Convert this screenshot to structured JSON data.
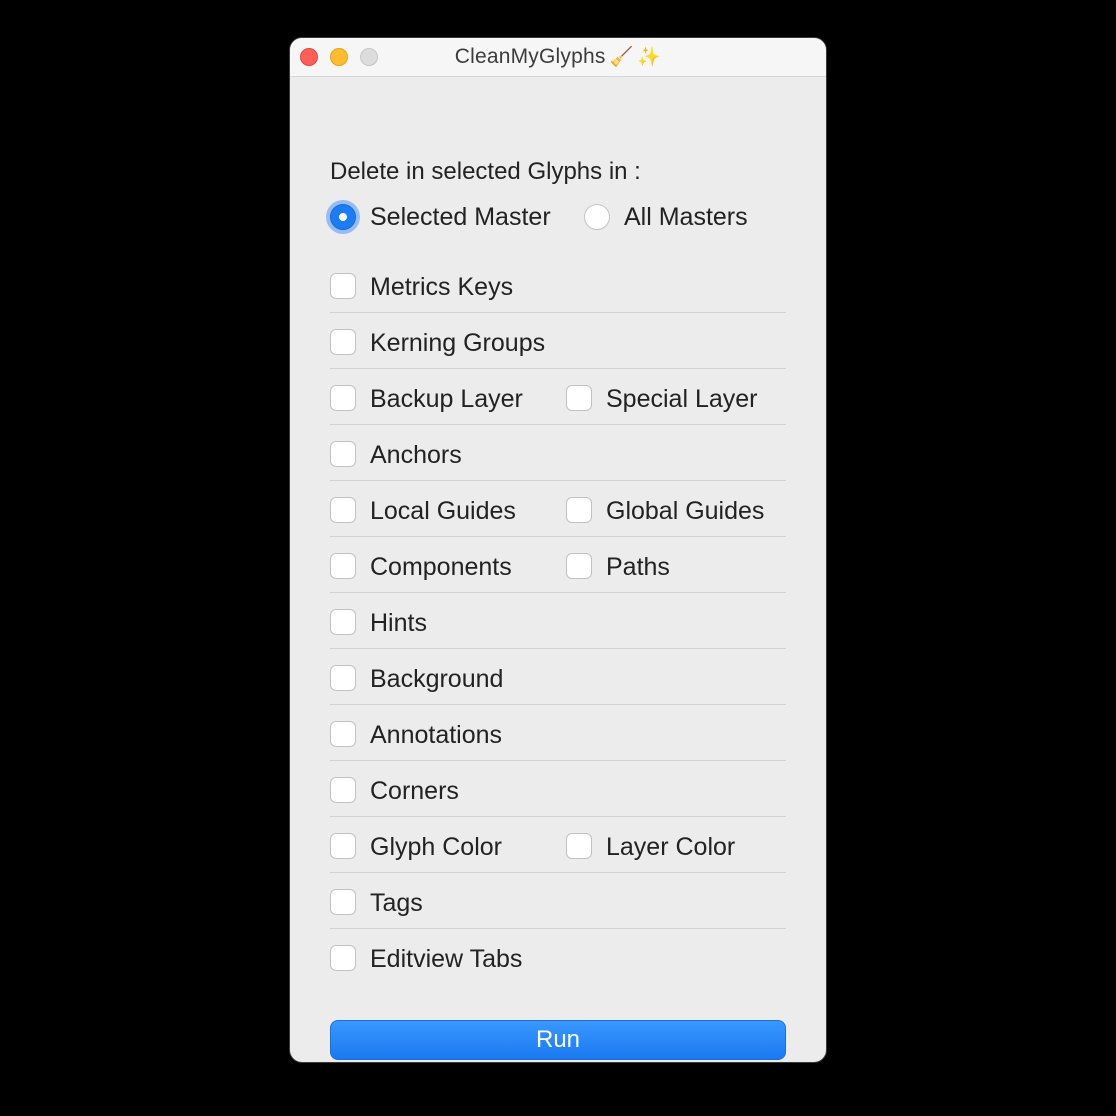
{
  "window": {
    "title": "CleanMyGlyphs",
    "title_icons": [
      "broom-icon",
      "sparkles-icon"
    ]
  },
  "heading": "Delete in selected Glyphs in :",
  "scope": {
    "options": [
      {
        "label": "Selected Master",
        "selected": true
      },
      {
        "label": "All Masters",
        "selected": false
      }
    ]
  },
  "options": [
    {
      "left": {
        "label": "Metrics Keys",
        "checked": false
      }
    },
    {
      "left": {
        "label": "Kerning Groups",
        "checked": false
      }
    },
    {
      "left": {
        "label": "Backup Layer",
        "checked": false
      },
      "right": {
        "label": "Special Layer",
        "checked": false
      }
    },
    {
      "left": {
        "label": "Anchors",
        "checked": false
      }
    },
    {
      "left": {
        "label": "Local Guides",
        "checked": false
      },
      "right": {
        "label": "Global Guides",
        "checked": false
      }
    },
    {
      "left": {
        "label": "Components",
        "checked": false
      },
      "right": {
        "label": "Paths",
        "checked": false
      }
    },
    {
      "left": {
        "label": "Hints",
        "checked": false
      }
    },
    {
      "left": {
        "label": "Background",
        "checked": false
      }
    },
    {
      "left": {
        "label": "Annotations",
        "checked": false
      }
    },
    {
      "left": {
        "label": "Corners",
        "checked": false
      }
    },
    {
      "left": {
        "label": "Glyph Color",
        "checked": false
      },
      "right": {
        "label": "Layer Color",
        "checked": false
      }
    },
    {
      "left": {
        "label": "Tags",
        "checked": false
      }
    },
    {
      "left": {
        "label": "Editview Tabs",
        "checked": false
      }
    }
  ],
  "run_button": {
    "label": "Run"
  },
  "colors": {
    "accent": "#1c7cf4",
    "window_bg": "#ececec",
    "close": "#fe5f57",
    "minimize": "#febc2e"
  }
}
